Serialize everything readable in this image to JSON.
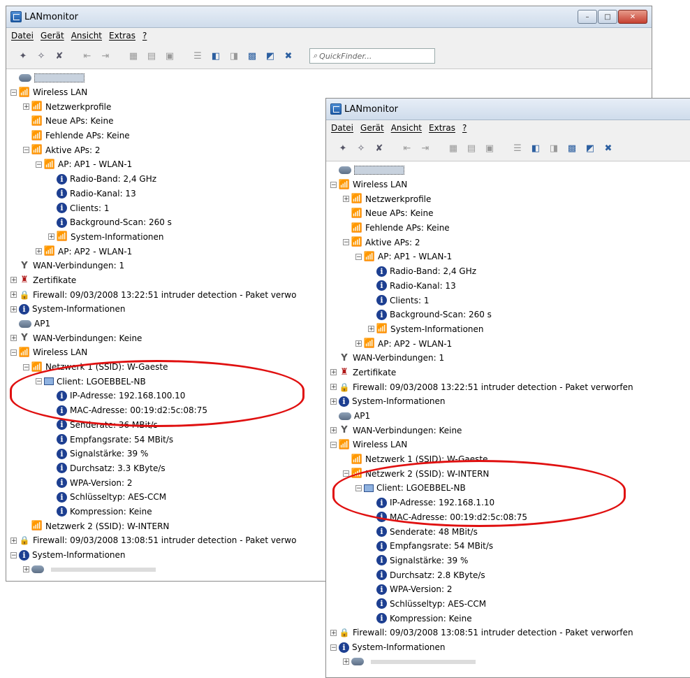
{
  "windows": [
    {
      "title": "LANmonitor",
      "caption": {
        "min": "–",
        "max": "□",
        "close": "✕"
      },
      "menu": [
        "Datei",
        "Gerät",
        "Ansicht",
        "Extras",
        "?"
      ],
      "quickfinder_placeholder": "QuickFinder...",
      "tree": [
        {
          "d": 0,
          "icon": "device",
          "exp": "",
          "text": "",
          "sel": true
        },
        {
          "d": 0,
          "icon": "wifi",
          "exp": "-",
          "text": "Wireless LAN"
        },
        {
          "d": 1,
          "icon": "wifi",
          "exp": "+",
          "text": "Netzwerkprofile"
        },
        {
          "d": 1,
          "icon": "wifi",
          "exp": "",
          "text": "Neue APs: Keine"
        },
        {
          "d": 1,
          "icon": "wifi",
          "exp": "",
          "text": "Fehlende APs: Keine"
        },
        {
          "d": 1,
          "icon": "wifi",
          "exp": "-",
          "text": "Aktive APs: 2"
        },
        {
          "d": 2,
          "icon": "wifi",
          "exp": "-",
          "text": "AP: AP1 - WLAN-1"
        },
        {
          "d": 3,
          "icon": "info",
          "exp": "",
          "text": "Radio-Band: 2,4 GHz"
        },
        {
          "d": 3,
          "icon": "info",
          "exp": "",
          "text": "Radio-Kanal: 13"
        },
        {
          "d": 3,
          "icon": "info",
          "exp": "",
          "text": "Clients: 1"
        },
        {
          "d": 3,
          "icon": "info",
          "exp": "",
          "text": "Background-Scan: 260 s"
        },
        {
          "d": 3,
          "icon": "wifi",
          "exp": "+",
          "text": "System-Informationen"
        },
        {
          "d": 2,
          "icon": "wifi",
          "exp": "+",
          "text": "AP: AP2 - WLAN-1"
        },
        {
          "d": 0,
          "icon": "wan",
          "exp": "",
          "text": "WAN-Verbindungen: 1"
        },
        {
          "d": 0,
          "icon": "cert",
          "exp": "+",
          "text": "Zertifikate"
        },
        {
          "d": 0,
          "icon": "fw",
          "exp": "+",
          "text": "Firewall: 09/03/2008 13:22:51 intruder detection - Paket verwo"
        },
        {
          "d": 0,
          "icon": "info",
          "exp": "+",
          "text": "System-Informationen"
        },
        {
          "d": 0,
          "icon": "device",
          "exp": "",
          "text": "AP1",
          "root": true
        },
        {
          "d": 0,
          "icon": "wan",
          "exp": "+",
          "text": "WAN-Verbindungen: Keine"
        },
        {
          "d": 0,
          "icon": "wifi",
          "exp": "-",
          "text": "Wireless LAN"
        },
        {
          "d": 1,
          "icon": "wifi",
          "exp": "-",
          "text": "Netzwerk 1 (SSID): W-Gaeste"
        },
        {
          "d": 2,
          "icon": "client",
          "exp": "-",
          "text": "Client: LGOEBBEL-NB"
        },
        {
          "d": 3,
          "icon": "info",
          "exp": "",
          "text": "IP-Adresse: 192.168.100.10"
        },
        {
          "d": 3,
          "icon": "info",
          "exp": "",
          "text": "MAC-Adresse: 00:19:d2:5c:08:75"
        },
        {
          "d": 3,
          "icon": "info",
          "exp": "",
          "text": "Senderate: 36 MBit/s"
        },
        {
          "d": 3,
          "icon": "info",
          "exp": "",
          "text": "Empfangsrate: 54 MBit/s"
        },
        {
          "d": 3,
          "icon": "info",
          "exp": "",
          "text": "Signalstärke: 39 %"
        },
        {
          "d": 3,
          "icon": "info",
          "exp": "",
          "text": "Durchsatz: 3.3 KByte/s"
        },
        {
          "d": 3,
          "icon": "info",
          "exp": "",
          "text": "WPA-Version: 2"
        },
        {
          "d": 3,
          "icon": "info",
          "exp": "",
          "text": "Schlüsseltyp: AES-CCM"
        },
        {
          "d": 3,
          "icon": "info",
          "exp": "",
          "text": "Kompression: Keine"
        },
        {
          "d": 1,
          "icon": "wifi",
          "exp": "",
          "text": "Netzwerk 2 (SSID): W-INTERN"
        },
        {
          "d": 0,
          "icon": "fw",
          "exp": "+",
          "text": "Firewall: 09/03/2008 13:08:51 intruder detection - Paket verwo"
        },
        {
          "d": 0,
          "icon": "info",
          "exp": "-",
          "text": "System-Informationen"
        },
        {
          "d": 1,
          "icon": "device",
          "exp": "+",
          "text": "",
          "redacted": true
        }
      ]
    },
    {
      "title": "LANmonitor",
      "menu": [
        "Datei",
        "Gerät",
        "Ansicht",
        "Extras",
        "?"
      ],
      "tree": [
        {
          "d": 0,
          "icon": "device",
          "exp": "",
          "text": "",
          "sel": true
        },
        {
          "d": 0,
          "icon": "wifi",
          "exp": "-",
          "text": "Wireless LAN"
        },
        {
          "d": 1,
          "icon": "wifi",
          "exp": "+",
          "text": "Netzwerkprofile"
        },
        {
          "d": 1,
          "icon": "wifi",
          "exp": "",
          "text": "Neue APs: Keine"
        },
        {
          "d": 1,
          "icon": "wifi",
          "exp": "",
          "text": "Fehlende APs: Keine"
        },
        {
          "d": 1,
          "icon": "wifi",
          "exp": "-",
          "text": "Aktive APs: 2"
        },
        {
          "d": 2,
          "icon": "wifi",
          "exp": "-",
          "text": "AP: AP1 - WLAN-1"
        },
        {
          "d": 3,
          "icon": "info",
          "exp": "",
          "text": "Radio-Band: 2,4 GHz"
        },
        {
          "d": 3,
          "icon": "info",
          "exp": "",
          "text": "Radio-Kanal: 13"
        },
        {
          "d": 3,
          "icon": "info",
          "exp": "",
          "text": "Clients: 1"
        },
        {
          "d": 3,
          "icon": "info",
          "exp": "",
          "text": "Background-Scan: 260 s"
        },
        {
          "d": 3,
          "icon": "wifi",
          "exp": "+",
          "text": "System-Informationen"
        },
        {
          "d": 2,
          "icon": "wifi",
          "exp": "+",
          "text": "AP: AP2 - WLAN-1"
        },
        {
          "d": 0,
          "icon": "wan",
          "exp": "",
          "text": "WAN-Verbindungen: 1"
        },
        {
          "d": 0,
          "icon": "cert",
          "exp": "+",
          "text": "Zertifikate"
        },
        {
          "d": 0,
          "icon": "fw",
          "exp": "+",
          "text": "Firewall: 09/03/2008 13:22:51 intruder detection - Paket verworfen"
        },
        {
          "d": 0,
          "icon": "info",
          "exp": "+",
          "text": "System-Informationen"
        },
        {
          "d": 0,
          "icon": "device",
          "exp": "",
          "text": "AP1",
          "root": true
        },
        {
          "d": 0,
          "icon": "wan",
          "exp": "+",
          "text": "WAN-Verbindungen: Keine"
        },
        {
          "d": 0,
          "icon": "wifi",
          "exp": "-",
          "text": "Wireless LAN"
        },
        {
          "d": 1,
          "icon": "wifi",
          "exp": "",
          "text": "Netzwerk 1 (SSID): W-Gaeste"
        },
        {
          "d": 1,
          "icon": "wifi",
          "exp": "-",
          "text": "Netzwerk 2 (SSID): W-INTERN"
        },
        {
          "d": 2,
          "icon": "client",
          "exp": "-",
          "text": "Client: LGOEBBEL-NB"
        },
        {
          "d": 3,
          "icon": "info",
          "exp": "",
          "text": "IP-Adresse: 192.168.1.10"
        },
        {
          "d": 3,
          "icon": "info",
          "exp": "",
          "text": "MAC-Adresse: 00:19:d2:5c:08:75"
        },
        {
          "d": 3,
          "icon": "info",
          "exp": "",
          "text": "Senderate: 48 MBit/s"
        },
        {
          "d": 3,
          "icon": "info",
          "exp": "",
          "text": "Empfangsrate: 54 MBit/s"
        },
        {
          "d": 3,
          "icon": "info",
          "exp": "",
          "text": "Signalstärke: 39 %"
        },
        {
          "d": 3,
          "icon": "info",
          "exp": "",
          "text": "Durchsatz: 2.8 KByte/s"
        },
        {
          "d": 3,
          "icon": "info",
          "exp": "",
          "text": "WPA-Version: 2"
        },
        {
          "d": 3,
          "icon": "info",
          "exp": "",
          "text": "Schlüsseltyp: AES-CCM"
        },
        {
          "d": 3,
          "icon": "info",
          "exp": "",
          "text": "Kompression: Keine"
        },
        {
          "d": 0,
          "icon": "fw",
          "exp": "+",
          "text": "Firewall: 09/03/2008 13:08:51 intruder detection - Paket verworfen"
        },
        {
          "d": 0,
          "icon": "info",
          "exp": "-",
          "text": "System-Informationen"
        },
        {
          "d": 1,
          "icon": "device",
          "exp": "+",
          "text": "",
          "redacted": true
        }
      ]
    }
  ],
  "annotation_color": "#e01010"
}
